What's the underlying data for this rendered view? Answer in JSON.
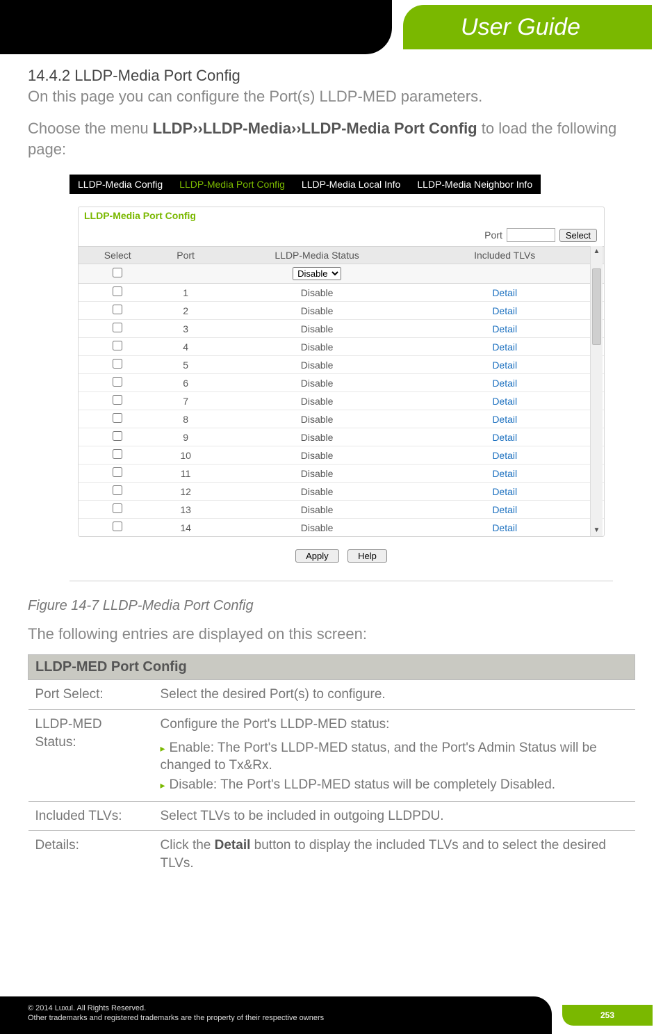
{
  "header": {
    "brand": "User Guide"
  },
  "section": {
    "number_title": "14.4.2 LLDP-Media Port Config",
    "intro": "On this page you can configure the Port(s) LLDP-MED parameters.",
    "menu_path_prefix": "Choose the menu ",
    "menu_path_bold": "LLDP››LLDP-Media››LLDP-Media Port Config",
    "menu_path_suffix": " to load the following page:"
  },
  "panel": {
    "tabs": [
      "LLDP-Media Config",
      "LLDP-Media Port Config",
      "LLDP-Media Local Info",
      "LLDP-Media Neighbor Info"
    ],
    "active_tab_index": 1,
    "card_title": "LLDP-Media Port Config",
    "port_label": "Port",
    "select_button": "Select",
    "columns": [
      "Select",
      "Port",
      "LLDP-Media Status",
      "Included TLVs"
    ],
    "status_dropdown_value": "Disable",
    "rows": [
      {
        "port": "1",
        "status": "Disable",
        "detail": "Detail"
      },
      {
        "port": "2",
        "status": "Disable",
        "detail": "Detail"
      },
      {
        "port": "3",
        "status": "Disable",
        "detail": "Detail"
      },
      {
        "port": "4",
        "status": "Disable",
        "detail": "Detail"
      },
      {
        "port": "5",
        "status": "Disable",
        "detail": "Detail"
      },
      {
        "port": "6",
        "status": "Disable",
        "detail": "Detail"
      },
      {
        "port": "7",
        "status": "Disable",
        "detail": "Detail"
      },
      {
        "port": "8",
        "status": "Disable",
        "detail": "Detail"
      },
      {
        "port": "9",
        "status": "Disable",
        "detail": "Detail"
      },
      {
        "port": "10",
        "status": "Disable",
        "detail": "Detail"
      },
      {
        "port": "11",
        "status": "Disable",
        "detail": "Detail"
      },
      {
        "port": "12",
        "status": "Disable",
        "detail": "Detail"
      },
      {
        "port": "13",
        "status": "Disable",
        "detail": "Detail"
      },
      {
        "port": "14",
        "status": "Disable",
        "detail": "Detail"
      }
    ],
    "apply_button": "Apply",
    "help_button": "Help"
  },
  "figure_caption": "Figure 14-7 LLDP-Media Port Config",
  "following_line": "The following entries are displayed on this screen:",
  "def_table": {
    "section_title": "LLDP-MED Port Config",
    "rows": [
      {
        "label": "Port Select:",
        "desc": "Select the desired Port(s) to configure."
      },
      {
        "label": "LLDP-MED Status:",
        "desc": "Configure the Port's LLDP-MED status:",
        "bullets": [
          "Enable: The Port's LLDP-MED status, and the Port's Admin Status will be changed to Tx&Rx.",
          "Disable: The Port's LLDP-MED status will be completely Disabled."
        ]
      },
      {
        "label": "Included TLVs:",
        "desc": "Select TLVs to be included in outgoing LLDPDU."
      },
      {
        "label": "Details:",
        "desc_prefix": "Click the ",
        "desc_bold": "Detail",
        "desc_suffix": " button to display the included TLVs and to select the desired TLVs."
      }
    ]
  },
  "footer": {
    "copyright": "© 2014  Luxul. All Rights Reserved.",
    "trademark": "Other trademarks and registered trademarks are the property of their respective owners",
    "page_number": "253"
  }
}
